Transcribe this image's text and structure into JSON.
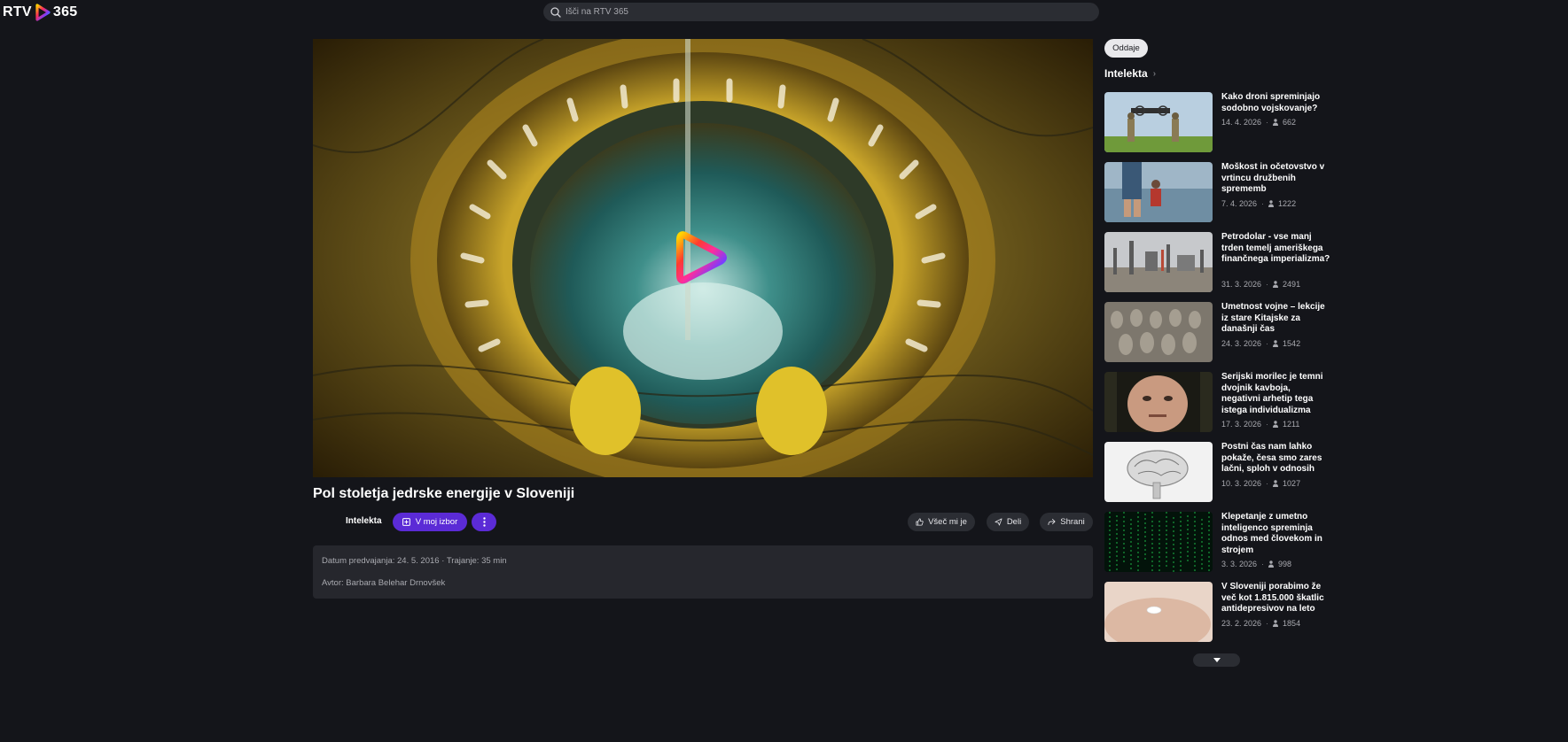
{
  "app": {
    "logo_text": "RTV",
    "logo_suffix": "365"
  },
  "search": {
    "placeholder": "Išči na RTV 365"
  },
  "video": {
    "title": "Pol stoletja jedrske energije v Sloveniji",
    "show_name": "Intelekta",
    "my_list_label": "V moj izbor",
    "like_label": "Všeč mi je",
    "share_label": "Deli",
    "save_label": "Shrani",
    "info_line1": "Datum predvajanja: 24. 5. 2016  ·  Trajanje: 35 min",
    "info_line2": "Avtor: Barbara Belehar Drnovšek"
  },
  "sidebar": {
    "chip_label": "Oddaje",
    "heading": "Intelekta",
    "episodes": [
      {
        "title": "Kako droni spreminjajo sodobno vojskovanje?",
        "date": "14. 4. 2026",
        "views": "662",
        "thumb": "drones"
      },
      {
        "title": "Moškost in očetovstvo v vrtincu družbenih sprememb",
        "date": "7. 4. 2026",
        "views": "1222",
        "thumb": "father-child"
      },
      {
        "title": "Petrodolar - vse manj trden temelj ameriškega finančnega imperializma?",
        "date": "31. 3. 2026",
        "views": "2491",
        "thumb": "refinery"
      },
      {
        "title": "Umetnost vojne – lekcije iz stare Kitajske za današnji čas",
        "date": "24. 3. 2026",
        "views": "1542",
        "thumb": "terracotta"
      },
      {
        "title": "Serijski morilec je temni dvojnik kavboja, negativni arhetip tega istega individualizma",
        "date": "17. 3. 2026",
        "views": "1211",
        "thumb": "face"
      },
      {
        "title": "Postni čas nam lahko pokaže, česa smo zares lačni, sploh v odnosih",
        "date": "10. 3. 2026",
        "views": "1027",
        "thumb": "brain"
      },
      {
        "title": "Klepetanje z umetno inteligenco spreminja odnos med človekom in strojem",
        "date": "3. 3. 2026",
        "views": "998",
        "thumb": "matrix"
      },
      {
        "title": "V Sloveniji porabimo že več kot 1.815.000 škatlic antidepresivov na leto",
        "date": "23. 2. 2026",
        "views": "1854",
        "thumb": "pill"
      }
    ]
  },
  "colors": {
    "background": "#14151a",
    "accent_purple": "#5b2bd6",
    "panel": "#26272d",
    "button_dark": "#2b2d33"
  }
}
